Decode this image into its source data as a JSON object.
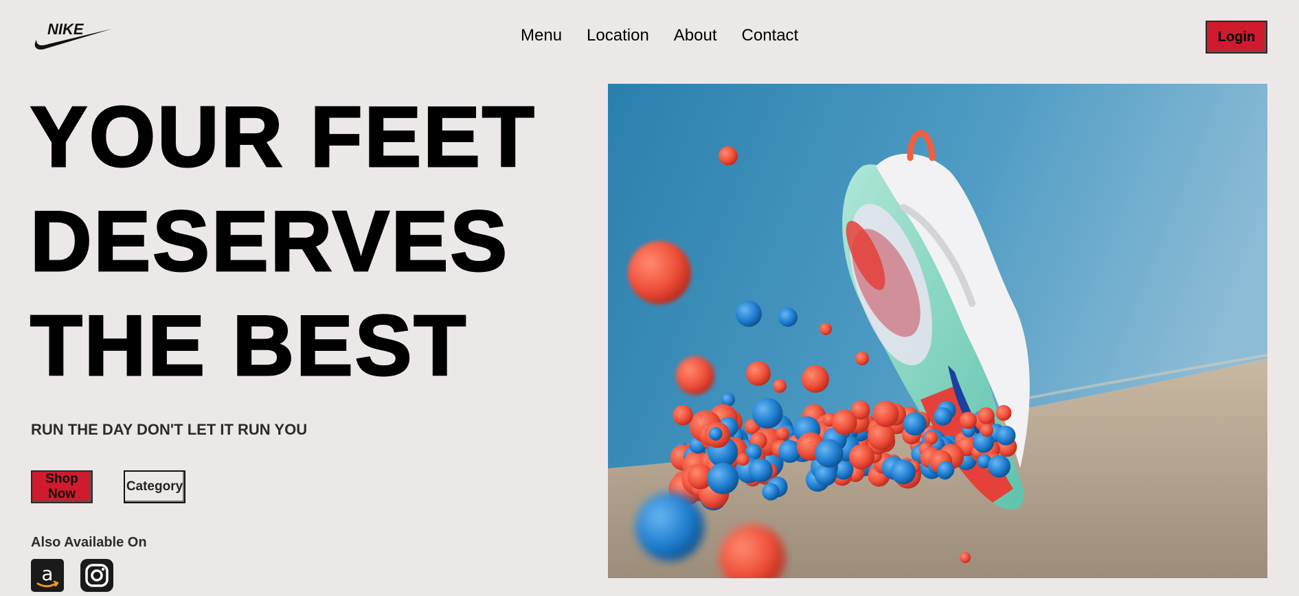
{
  "brand": {
    "logo_text": "NIKE"
  },
  "nav": {
    "items": [
      "Menu",
      "Location",
      "About",
      "Contact"
    ]
  },
  "header": {
    "login_label": "Login"
  },
  "hero": {
    "title_lines": [
      "YOUR FEET",
      "DESERVES",
      "THE BEST"
    ],
    "tagline": "RUN THE DAY DON'T LET IT RUN YOU",
    "shop_label": "Shop Now",
    "category_label": "Category",
    "also_available_label": "Also Available On"
  },
  "icons": {
    "logo": "nike-swoosh-icon",
    "store_1": "amazon-icon",
    "store_2": "instagram-icon"
  },
  "colors": {
    "background": "#ede8e8",
    "accent": "#cf1b2d",
    "text": "#000000",
    "sky": "#5a9ec4",
    "ball_red": "#f0503a",
    "ball_blue": "#1f7fd1"
  }
}
